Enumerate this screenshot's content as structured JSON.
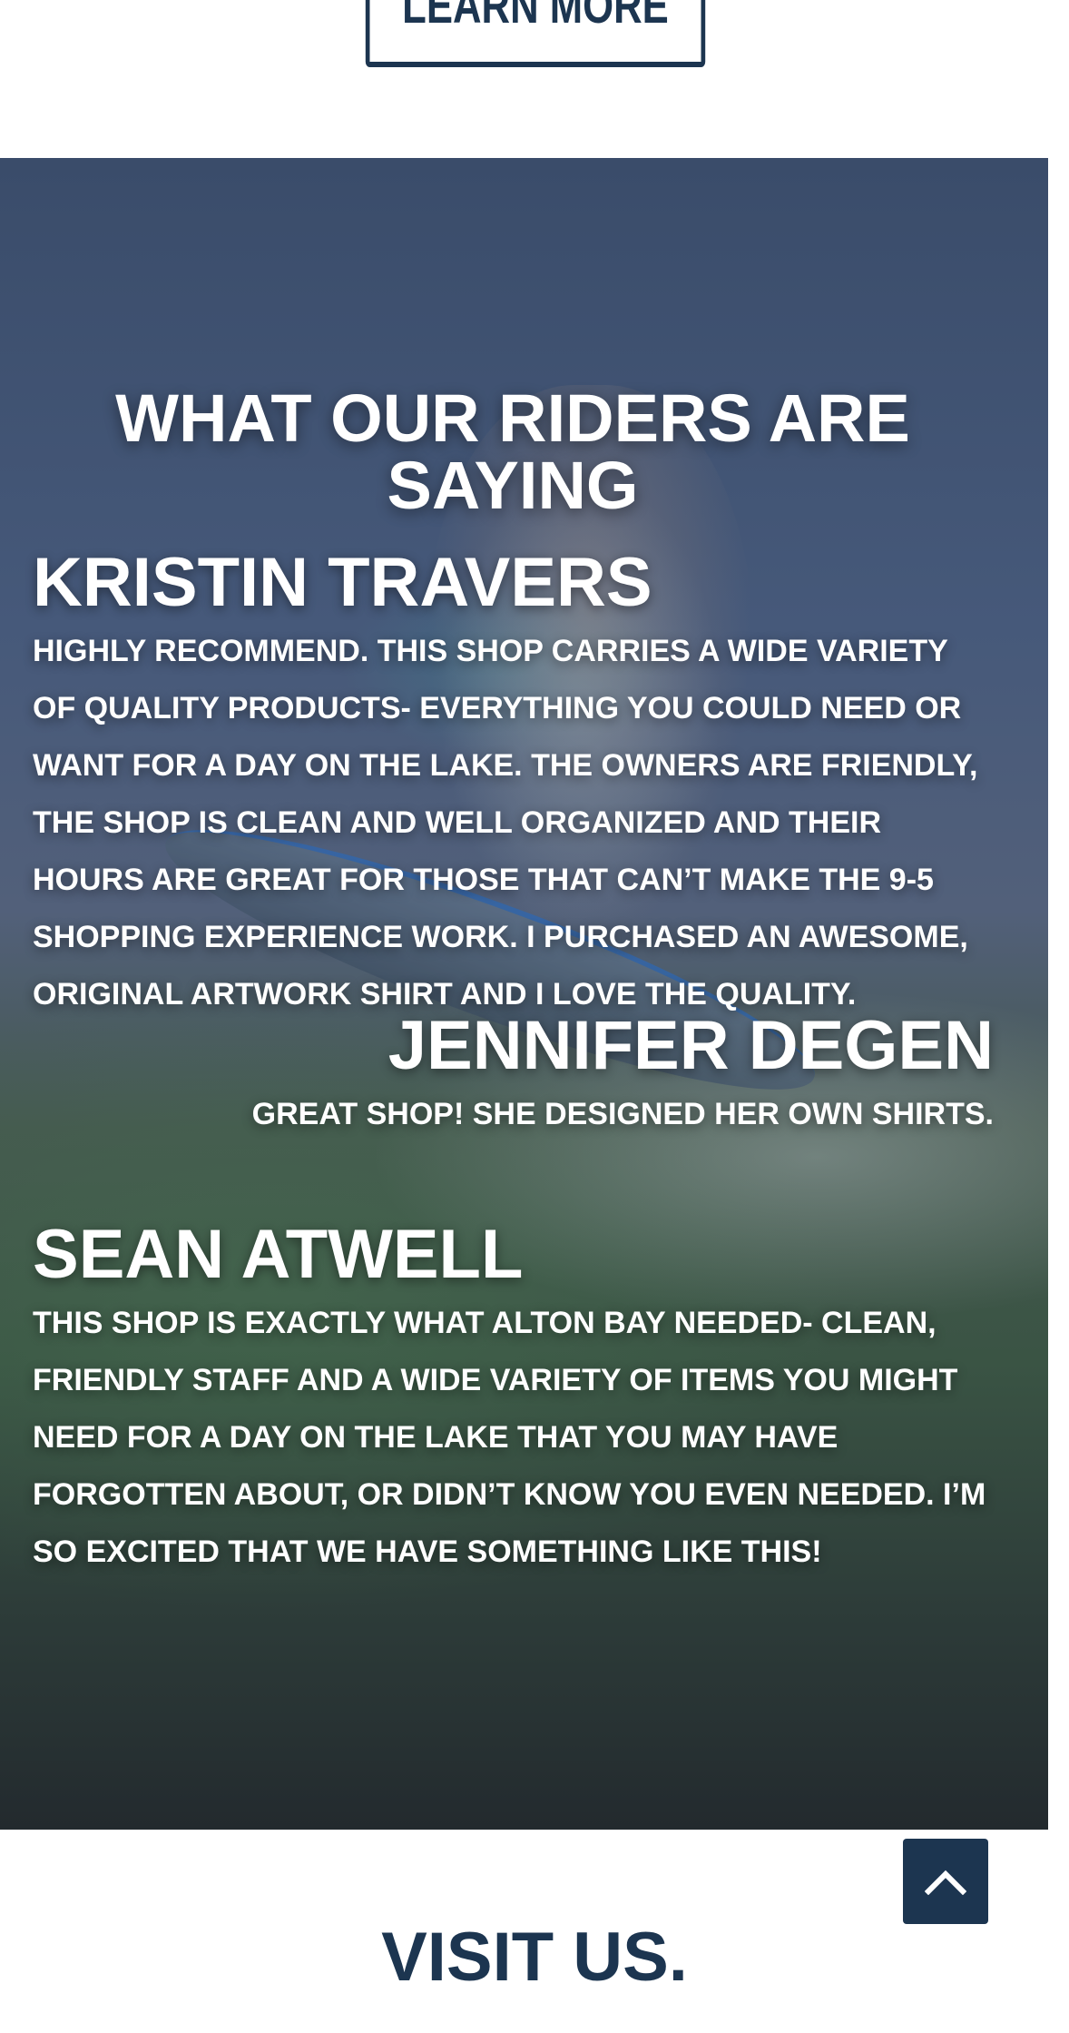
{
  "learn_more": {
    "label": "LEARN MORE"
  },
  "testimonials": {
    "title": "WHAT OUR RIDERS ARE SAYING",
    "reviews": [
      {
        "name": "KRISTIN TRAVERS",
        "text": "HIGHLY RECOMMEND. THIS SHOP CARRIES A WIDE VARIETY OF QUALITY PRODUCTS- EVERYTHING YOU COULD NEED OR WANT FOR A DAY ON THE LAKE. THE OWNERS ARE FRIENDLY, THE SHOP IS CLEAN AND WELL ORGANIZED AND THEIR HOURS ARE GREAT FOR THOSE THAT CAN’T MAKE THE 9-5 SHOPPING EXPERIENCE WORK. I PURCHASED AN AWESOME, ORIGINAL ARTWORK SHIRT AND I LOVE THE QUALITY."
      },
      {
        "name": "JENNIFER DEGEN",
        "text": "GREAT SHOP! SHE DESIGNED HER OWN SHIRTS."
      },
      {
        "name": "SEAN ATWELL",
        "text": "THIS SHOP IS EXACTLY WHAT ALTON BAY NEEDED- CLEAN, FRIENDLY STAFF AND A WIDE VARIETY OF ITEMS YOU MIGHT NEED FOR A DAY ON THE LAKE THAT YOU MAY HAVE FORGOTTEN ABOUT, OR DIDN’T KNOW YOU EVEN NEEDED. I’M SO EXCITED THAT WE HAVE SOMETHING LIKE THIS!"
      }
    ]
  },
  "scroll_top": {
    "icon": "chevron-up-icon"
  },
  "visit": {
    "title": "VISIT US."
  },
  "colors": {
    "brand_navy": "#1c3550",
    "text_light": "#ffffff"
  }
}
